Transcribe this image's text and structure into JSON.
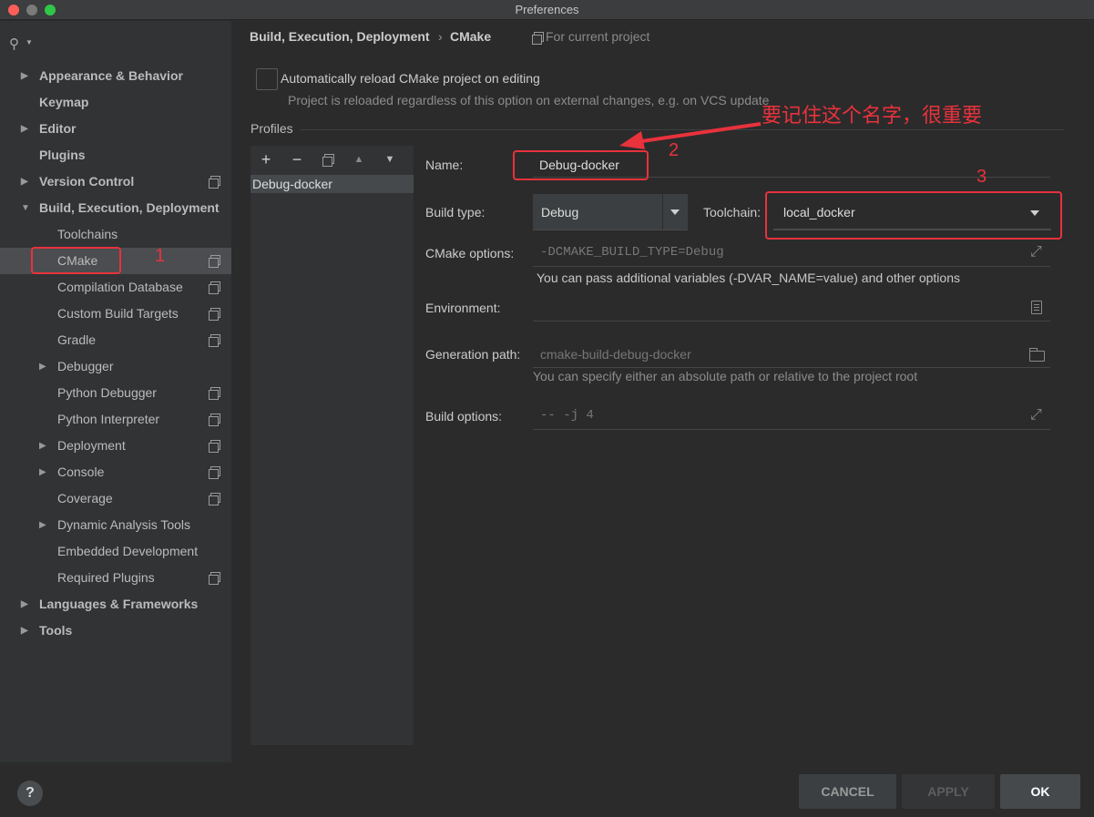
{
  "window": {
    "title": "Preferences"
  },
  "sidebar": {
    "items": [
      {
        "label": "Appearance & Behavior",
        "bold": true,
        "expandable": true,
        "indent": 0,
        "project": false
      },
      {
        "label": "Keymap",
        "bold": true,
        "expandable": false,
        "indent": 0,
        "project": false
      },
      {
        "label": "Editor",
        "bold": true,
        "expandable": true,
        "indent": 0,
        "project": false
      },
      {
        "label": "Plugins",
        "bold": true,
        "expandable": false,
        "indent": 0,
        "project": false
      },
      {
        "label": "Version Control",
        "bold": true,
        "expandable": true,
        "indent": 0,
        "project": true
      },
      {
        "label": "Build, Execution, Deployment",
        "bold": true,
        "expandable": true,
        "expanded": true,
        "indent": 0,
        "project": false
      },
      {
        "label": "Toolchains",
        "bold": false,
        "expandable": false,
        "indent": 1,
        "project": false
      },
      {
        "label": "CMake",
        "bold": false,
        "expandable": false,
        "indent": 1,
        "project": true,
        "selected": true
      },
      {
        "label": "Compilation Database",
        "bold": false,
        "expandable": false,
        "indent": 1,
        "project": true
      },
      {
        "label": "Custom Build Targets",
        "bold": false,
        "expandable": false,
        "indent": 1,
        "project": true
      },
      {
        "label": "Gradle",
        "bold": false,
        "expandable": false,
        "indent": 1,
        "project": true
      },
      {
        "label": "Debugger",
        "bold": false,
        "expandable": true,
        "indent": 1,
        "project": false
      },
      {
        "label": "Python Debugger",
        "bold": false,
        "expandable": false,
        "indent": 1,
        "project": true
      },
      {
        "label": "Python Interpreter",
        "bold": false,
        "expandable": false,
        "indent": 1,
        "project": true
      },
      {
        "label": "Deployment",
        "bold": false,
        "expandable": true,
        "indent": 1,
        "project": true
      },
      {
        "label": "Console",
        "bold": false,
        "expandable": true,
        "indent": 1,
        "project": true
      },
      {
        "label": "Coverage",
        "bold": false,
        "expandable": false,
        "indent": 1,
        "project": true
      },
      {
        "label": "Dynamic Analysis Tools",
        "bold": false,
        "expandable": true,
        "indent": 1,
        "project": false
      },
      {
        "label": "Embedded Development",
        "bold": false,
        "expandable": false,
        "indent": 1,
        "project": false
      },
      {
        "label": "Required Plugins",
        "bold": false,
        "expandable": false,
        "indent": 1,
        "project": true
      },
      {
        "label": "Languages & Frameworks",
        "bold": true,
        "expandable": true,
        "indent": 0,
        "project": false
      },
      {
        "label": "Tools",
        "bold": true,
        "expandable": true,
        "indent": 0,
        "project": false
      }
    ]
  },
  "header": {
    "breadcrumb_parent": "Build, Execution, Deployment",
    "breadcrumb_separator": "›",
    "breadcrumb_current": "CMake",
    "scope": "For current project"
  },
  "reload": {
    "label": "Automatically reload CMake project on editing",
    "description": "Project is reloaded regardless of this option on external changes, e.g. on VCS update",
    "checked": false
  },
  "profiles": {
    "title": "Profiles",
    "toolbar": {
      "add": "+",
      "remove": "−",
      "up": "▲",
      "down": "▼"
    },
    "items": [
      "Debug-docker"
    ]
  },
  "form": {
    "name_label": "Name:",
    "name_value": "Debug-docker",
    "build_type_label": "Build type:",
    "build_type_value": "Debug",
    "toolchain_label": "Toolchain:",
    "toolchain_value": "local_docker",
    "cmake_options_label": "CMake options:",
    "cmake_options_value": "-DCMAKE_BUILD_TYPE=Debug",
    "cmake_options_hint": "You can pass additional variables (-DVAR_NAME=value) and other options",
    "environment_label": "Environment:",
    "environment_value": "",
    "generation_path_label": "Generation path:",
    "generation_path_value": "cmake-build-debug-docker",
    "generation_path_hint": "You can specify either an absolute path or relative to the project root",
    "build_options_label": "Build options:",
    "build_options_value": "-- -j 4"
  },
  "annotations": {
    "num1": "1",
    "num2": "2",
    "num3": "3",
    "note": "要记住这个名字，很重要",
    "color": "#e8323c"
  },
  "footer": {
    "help": "?",
    "cancel": "CANCEL",
    "apply": "APPLY",
    "ok": "OK"
  }
}
